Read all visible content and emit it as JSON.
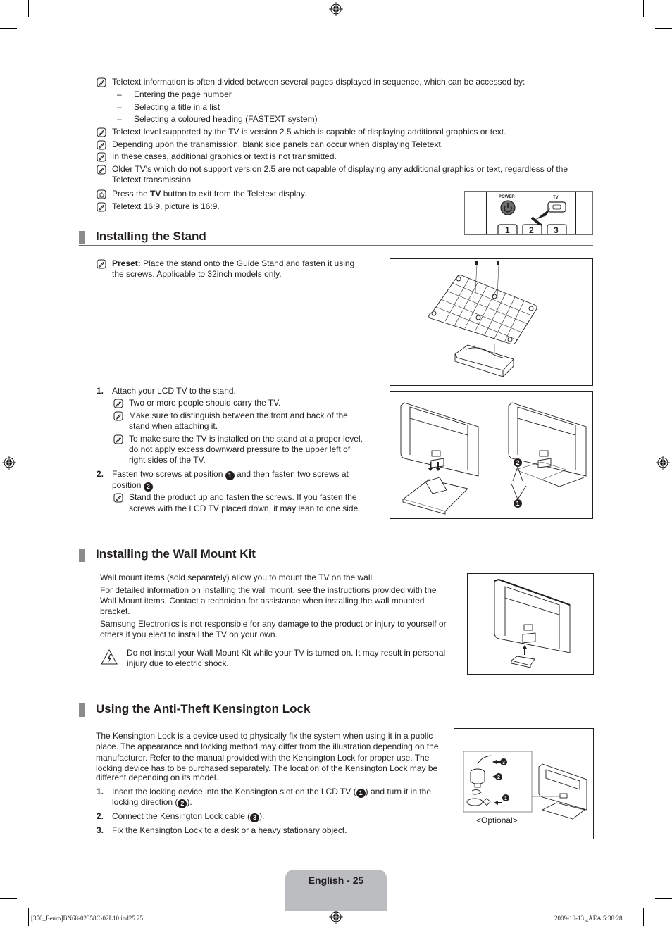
{
  "teletext": {
    "intro": "Teletext information is often divided between several pages displayed in sequence, which can be accessed by:",
    "access_methods": [
      "Entering the page number",
      "Selecting a title in a list",
      "Selecting a coloured heading (FASTEXT system)"
    ],
    "notes": [
      "Teletext level supported by the TV is version 2.5 which is capable of displaying additional graphics or text.",
      "Depending upon the transmission, blank side panels can occur when displaying Teletext.",
      "In these cases, additional graphics or text is not transmitted.",
      "Older TV's which do not support version 2.5 are not capable of displaying any additional graphics or text, regardless of the",
      "Teletext transmission."
    ],
    "press_prefix": "Press the ",
    "press_bold": "TV",
    "press_suffix": " button to exit from the Teletext display.",
    "last_note": "Teletext 16:9, picture is 16:9.",
    "remote": {
      "power_label": "POWER",
      "tv_label": "TV",
      "keys": [
        "1",
        "2",
        "3"
      ]
    }
  },
  "stand": {
    "title": "Installing the Stand",
    "preset_bold": "Preset:",
    "preset_line1": " Place the stand onto the Guide Stand and fasten it using",
    "preset_line2": "the screws. Applicable to 32inch models only.",
    "step1_num": "1.",
    "step1": "Attach your LCD TV to the stand.",
    "step1_notes": [
      "Two or more people should carry the TV.",
      "Make sure to distinguish between the front and back of the",
      "stand when attaching it.",
      "To make sure the TV is installed on the stand at a proper level,",
      "do not apply excess downward pressure to the upper left of",
      "right sides of the TV."
    ],
    "step2_num": "2.",
    "step2_a": "Fasten two screws at position ",
    "step2_b": " and then fasten two screws at",
    "step2_c": "position ",
    "step2_d": ".",
    "step2_note_1": "Stand the product up and fasten the screws. If you fasten the",
    "step2_note_2": "screws with the LCD TV placed down, it may lean to one side.",
    "marker_1": "1",
    "marker_2": "2"
  },
  "wall": {
    "title": "Installing the Wall Mount Kit",
    "p1": "Wall mount items (sold separately) allow you to mount the TV on the wall.",
    "p2_l1": "For detailed information on installing the wall mount, see the instructions provided with the",
    "p2_l2": "Wall Mount items. Contact a technician for assistance when installing the wall mounted",
    "p2_l3": "bracket.",
    "p3_l1": "Samsung Electronics is not responsible for any damage to the product or injury to yourself or",
    "p3_l2": "others if you elect to install the TV on your own.",
    "warn_l1": "Do not install your Wall Mount Kit while your TV is turned on. It may result in personal",
    "warn_l2": "injury due to electric shock."
  },
  "kensington": {
    "title": "Using the Anti-Theft Kensington Lock",
    "intro": [
      "The Kensington Lock is a device used to physically fix the system when using it in a public",
      "place. The appearance and locking method may differ from the illustration depending on the",
      "manufacturer. Refer to the manual provided with the Kensington Lock for proper use. The",
      "locking device has to be purchased separately. The location of the Kensington Lock may be",
      "different depending on its model."
    ],
    "step1_num": "1.",
    "step1_a": "Insert the locking device into the Kensington slot on the LCD TV (",
    "step1_b": ") and turn it in the",
    "step1_c": "locking direction (",
    "step1_d": ").",
    "step2_num": "2.",
    "step2_a": "Connect the Kensington Lock cable (",
    "step2_b": ").",
    "step3_num": "3.",
    "step3": "Fix the Kensington Lock to a desk or a heavy stationary object.",
    "optional_label": "<Optional>",
    "m1": "1",
    "m2": "2",
    "m3": "3"
  },
  "footer": {
    "page_label": "English - 25",
    "slug_left": "[350_Eeuro]BN68-02358C-02L10.ind25   25",
    "slug_right": "2009-10-13   ¿ÀÈÄ 5:38:28"
  }
}
